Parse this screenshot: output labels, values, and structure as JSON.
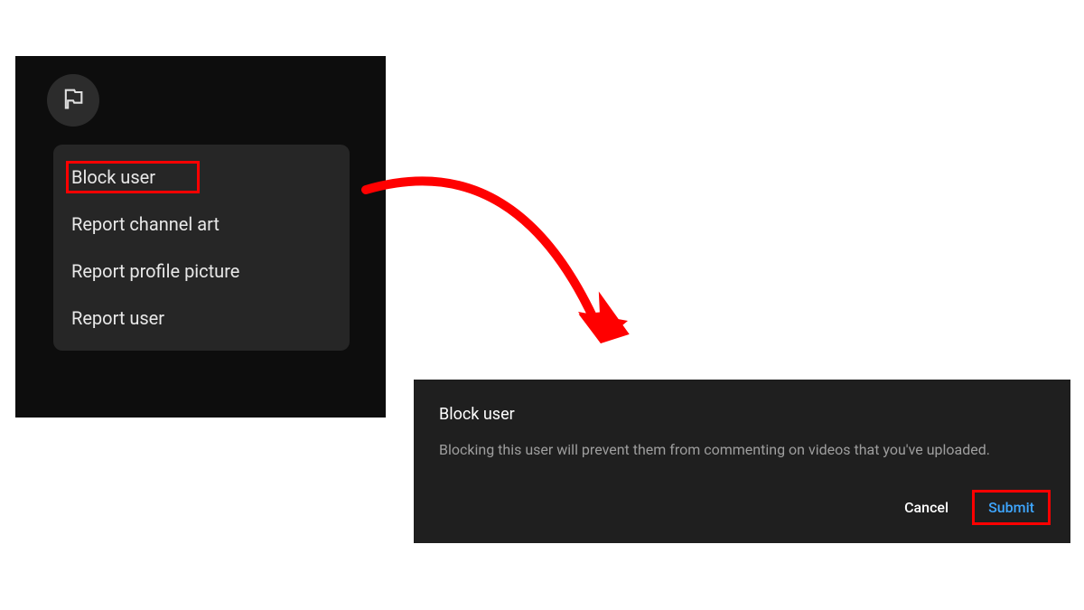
{
  "menu": {
    "items": [
      {
        "label": "Block user",
        "highlighted": true
      },
      {
        "label": "Report channel art",
        "highlighted": false
      },
      {
        "label": "Report profile picture",
        "highlighted": false
      },
      {
        "label": "Report user",
        "highlighted": false
      }
    ]
  },
  "dialog": {
    "title": "Block user",
    "message": "Blocking this user will prevent them from commenting on videos that you've uploaded.",
    "cancel_label": "Cancel",
    "submit_label": "Submit"
  },
  "colors": {
    "highlight_border": "#ff0000",
    "submit_text": "#3ea6ff",
    "panel_bg_dark": "#0d0d0d",
    "dropdown_bg": "#262626",
    "dialog_bg": "#1f1f1f"
  }
}
